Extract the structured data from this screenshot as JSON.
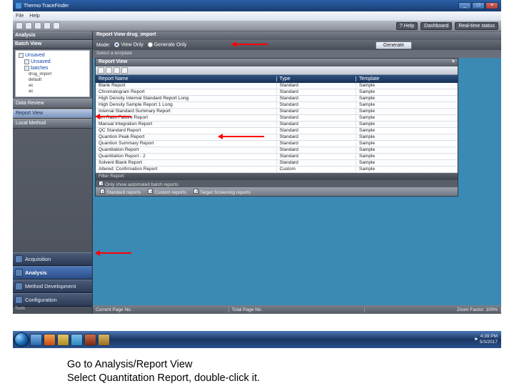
{
  "window": {
    "title": "Thermo TraceFinder"
  },
  "menu": {
    "file": "File",
    "help": "Help"
  },
  "toolbar_right": {
    "help": "Help",
    "dashboard": "Dashboard",
    "realtime": "Real-time status"
  },
  "sidebar": {
    "analysis_hdr": "Analysis",
    "batch_hdr": "Batch View",
    "tree": {
      "root": "Unsaved",
      "batches": "batches",
      "leaf1": "drug_import",
      "leaf2": "default",
      "leaf3": "ac",
      "leaf4": "ac"
    },
    "nav": {
      "data_review": "Data Review",
      "report_view": "Report View",
      "local_method": "Local Method"
    },
    "bottom": {
      "acquisition": "Acquisition",
      "analysis": "Analysis",
      "method_dev": "Method Development",
      "configuration": "Configuration"
    },
    "tools": "Tools"
  },
  "main": {
    "header": "Report View  drug_import",
    "mode_label": "Mode:",
    "view_only": "View Only",
    "generate_only": "Generate Only",
    "generate_btn": "Generate",
    "select_template": "Select a template",
    "report_view_hdr": "Report View",
    "columns": {
      "name": "Report Name",
      "type": "Type",
      "template": "Template"
    },
    "rows": [
      {
        "name": "Blank Report",
        "type": "Standard",
        "template": "Sample"
      },
      {
        "name": "Chromatogram Report",
        "type": "Standard",
        "template": "Sample"
      },
      {
        "name": "High Density Internal Standard Report Long",
        "type": "Standard",
        "template": "Sample"
      },
      {
        "name": "High Density Sample Report 1 Long",
        "type": "Standard",
        "template": "Sample"
      },
      {
        "name": "Internal Standard Summary Report",
        "type": "Standard",
        "template": "Sample"
      },
      {
        "name": "Ion Ratio Failure Report",
        "type": "Standard",
        "template": "Sample"
      },
      {
        "name": "Manual Integration Report",
        "type": "Standard",
        "template": "Sample"
      },
      {
        "name": "QC Standard Report",
        "type": "Standard",
        "template": "Sample"
      },
      {
        "name": "Quantion Peak Report",
        "type": "Standard",
        "template": "Sample"
      },
      {
        "name": "Quantion Summary Report",
        "type": "Standard",
        "template": "Sample"
      },
      {
        "name": "Quantitation Report",
        "type": "Standard",
        "template": "Sample"
      },
      {
        "name": "Quantitation Report - 2",
        "type": "Standard",
        "template": "Sample"
      },
      {
        "name": "Solvent Blank Report",
        "type": "Standard",
        "template": "Sample"
      },
      {
        "name": "Altered: Confirmation Report",
        "type": "Custom",
        "template": "Sample"
      }
    ],
    "filter_label": "Filter Report",
    "filter_sub": "Only show automated batch reports",
    "foot": {
      "std": "Standard reports",
      "custom": "Custom reports",
      "target": "Target Screening reports"
    },
    "status": {
      "left": "Current Page No.",
      "mid": "Total Page No.",
      "right": "Zoom Factor: 100%"
    }
  },
  "taskbar": {
    "time": "4:39 PM",
    "date": "5/3/2017"
  },
  "instruction": {
    "line1": "Go to Analysis/Report View",
    "line2": "Select Quantitation Report, double-click it."
  }
}
